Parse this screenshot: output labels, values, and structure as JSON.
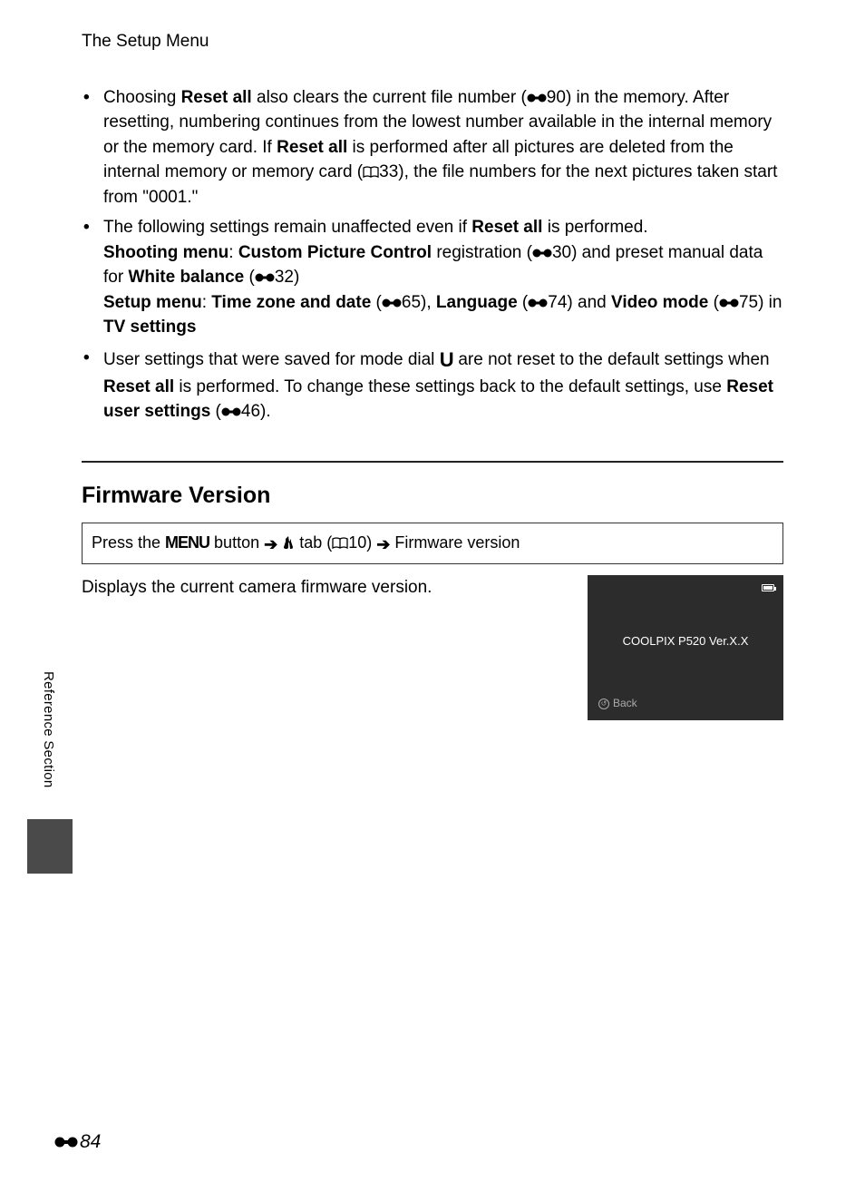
{
  "header": {
    "title": "The Setup Menu"
  },
  "bullets": {
    "b1": {
      "t1": "Choosing ",
      "bold1": "Reset all",
      "t2": " also clears the current file number (",
      "ref1": "90",
      "t3": ") in the memory. After resetting, numbering continues from the lowest number available in the internal memory or the memory card. If ",
      "bold2": "Reset all",
      "t4": " is performed after all pictures are deleted from the internal memory or memory card (",
      "book1": "33",
      "t5": "), the file numbers for the next pictures taken start from \"0001.\""
    },
    "b2": {
      "t1": "The following settings remain unaffected even if ",
      "bold1": "Reset all",
      "t2": " is performed.",
      "line2a": "Shooting menu",
      "line2b": ": ",
      "line2c": "Custom Picture Control",
      "line2d": " registration (",
      "ref1": "30",
      "line2e": ") and preset manual data for ",
      "line2f": "White balance",
      "line2g": " (",
      "ref2": "32",
      "line2h": ")",
      "line3a": "Setup menu",
      "line3b": ": ",
      "line3c": "Time zone and date",
      "line3d": " (",
      "ref3": "65",
      "line3e": "), ",
      "line3f": "Language",
      "line3g": " (",
      "ref4": "74",
      "line3h": ") and ",
      "line3i": "Video mode",
      "line3j": " (",
      "ref5": "75",
      "line3k": ") in ",
      "line3l": "TV settings"
    },
    "b3": {
      "t1": "User settings that were saved for mode dial ",
      "u": "U",
      "t2": " are not reset to the default settings when ",
      "bold1": "Reset all",
      "t3": " is performed. To change these settings back to the default settings, use ",
      "bold2": "Reset user settings",
      "t4": " (",
      "ref1": "46",
      "t5": ")."
    }
  },
  "section": {
    "heading": "Firmware Version",
    "nav": {
      "t1": "Press the ",
      "menu": "MENU",
      "t2": " button ",
      "arrow": "➔",
      "t3": " ",
      "t4": " tab (",
      "book": "10",
      "t5": ") ",
      "t6": " Firmware version"
    },
    "body": "Displays the current camera firmware version.",
    "screen": {
      "fw": "COOLPIX P520 Ver.X.X",
      "back": "Back"
    }
  },
  "side": {
    "label": "Reference Section"
  },
  "page_number": "84"
}
